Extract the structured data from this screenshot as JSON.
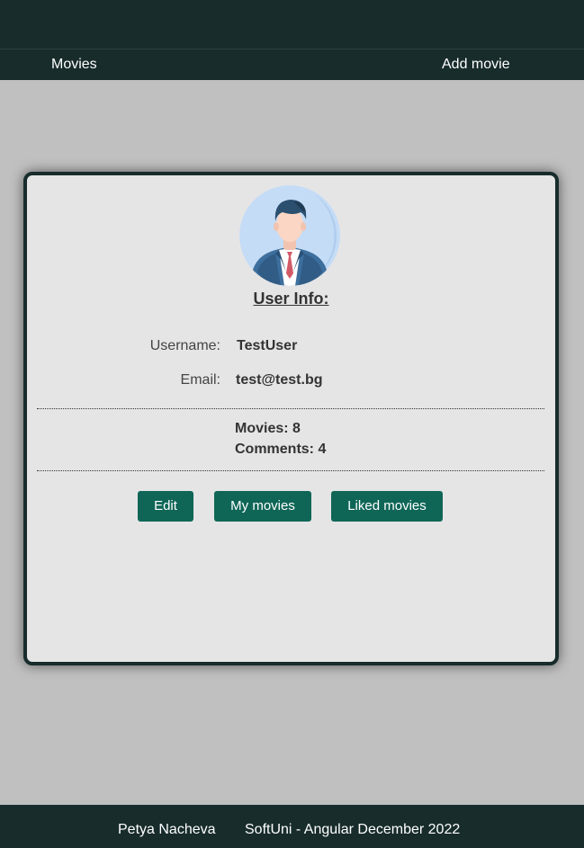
{
  "nav": {
    "movies_label": "Movies",
    "add_movie_label": "Add movie"
  },
  "profile": {
    "title": "User Info:",
    "username_label": "Username:",
    "username_value": "TestUser",
    "email_label": "Email:",
    "email_value": "test@test.bg",
    "movies_stat": "Movies: 8",
    "comments_stat": "Comments: 4"
  },
  "actions": {
    "edit_label": "Edit",
    "my_movies_label": "My movies",
    "liked_movies_label": "Liked movies"
  },
  "footer": {
    "author": "Petya Nacheva",
    "course": "SoftUni - Angular December 2022"
  },
  "colors": {
    "header_bg": "#182c2c",
    "button_bg": "#0f6657",
    "page_bg": "#c0c0c0",
    "card_bg": "#e5e5e6"
  },
  "icons": {
    "avatar": "user-avatar-businessman-icon"
  }
}
